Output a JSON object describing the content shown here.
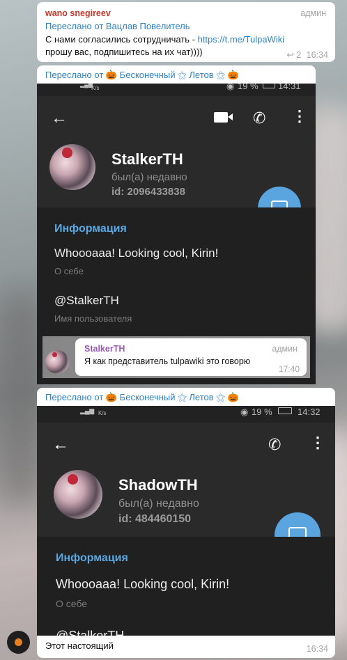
{
  "message1": {
    "sender": "wano snegireev",
    "role": "админ",
    "forwarded_from": "Переслано от Вацлав Повелитель",
    "text_line1": "С нами согласились сотрудничать - ",
    "link": "https://t.me/TulpaWiki",
    "text_line2": "прошу вас, подпишитесь на их чат))))",
    "reply_count": "2",
    "time": "16:34"
  },
  "forward_bar1": "Переслано от 🎃 Бесконечный ⚝ Летов ⚝ 🎃",
  "shot1": {
    "status_left": "K/s",
    "status_right": "19 %",
    "status_time": "14:31",
    "profile_name": "StalkerTH",
    "profile_status": "был(а) недавно",
    "profile_id": "id: 2096433838",
    "section_title": "Информация",
    "bio": "Whoooaaa! Looking cool, Kirin!",
    "bio_label": "О себе",
    "username": "@StalkerTH",
    "username_label": "Имя пользователя",
    "nested_msg": {
      "sender": "StalkerTH",
      "role": "админ",
      "text": "Я как представитель tulpawiki это говорю",
      "time": "17:40"
    }
  },
  "forward_bar2": "Переслано от 🎃 Бесконечный ⚝ Летов ⚝ 🎃",
  "shot2": {
    "status_left": "K/s",
    "status_right": "19 %",
    "status_time": "14:32",
    "profile_name": "ShadowTH",
    "profile_status": "был(а) недавно",
    "profile_id": "id: 484460150",
    "section_title": "Информация",
    "bio": "Whoooaaa! Looking cool, Kirin!",
    "bio_label": "О себе",
    "username": "@StalkerTH"
  },
  "bottom_msg": {
    "text": "Этот настоящий",
    "time": "16:34"
  },
  "icons": {
    "back": "back-arrow-icon",
    "video": "video-call-icon",
    "call": "phone-icon",
    "menu": "more-vert-icon",
    "message": "message-fab-icon",
    "reply": "reply-icon",
    "pumpkin": "pumpkin-icon"
  }
}
